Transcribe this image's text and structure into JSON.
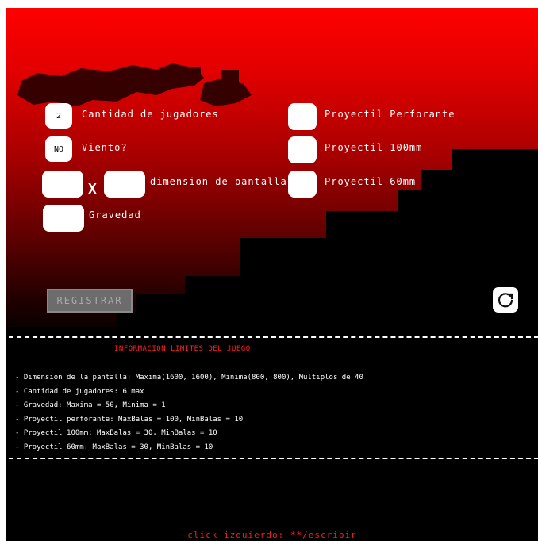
{
  "setup": {
    "players_value": "2",
    "players_label": "Cantidad de jugadores",
    "wind_value": "NO",
    "wind_label": "Viento?",
    "width_value": "",
    "times_symbol": "X",
    "height_value": "",
    "dimension_label": "dimension de pantalla",
    "gravity_value": "",
    "gravity_label": "Gravedad",
    "piercing_value": "",
    "piercing_label": "Proyectil Perforante",
    "p100_value": "",
    "p100_label": "Proyectil 100mm",
    "p60_value": "",
    "p60_label": "Proyectil 60mm"
  },
  "actions": {
    "register_label": "REGISTRAR",
    "reload_icon": "reload-icon"
  },
  "info": {
    "title": "INFORMACION LIMITES DEL JUEGO",
    "rules": [
      "- Dimension de la pantalla: Maxima(1600, 1600), Minima(800, 800), Multiplos de 40",
      "- Cantidad de jugadores: 6 max",
      "- Gravedad: Maxima = 50, Minima = 1",
      "- Proyectil perforante: MaxBalas = 100, MinBalas = 10",
      "- Proyectil 100mm: MaxBalas = 30, MinBalas = 10",
      "- Proyectil 60mm: MaxBalas = 30, MinBalas = 10"
    ]
  },
  "footer": {
    "hint": "click izquierdo: **/escribir"
  },
  "colors": {
    "sky_top": "#ff0000",
    "info_red": "#ff2020",
    "terrain": "#000000"
  }
}
